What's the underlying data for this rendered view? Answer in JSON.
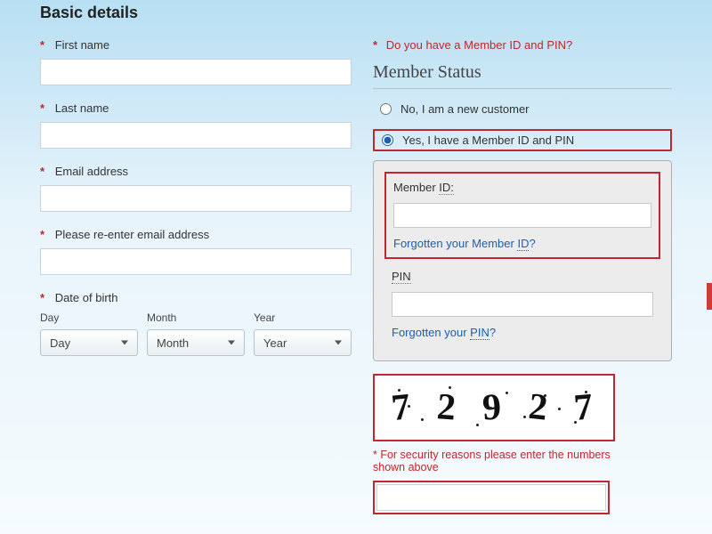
{
  "section_title": "Basic details",
  "left": {
    "first_name_label": "First name",
    "last_name_label": "Last name",
    "email_label": "Email address",
    "reemail_label": "Please re-enter email address",
    "dob_label": "Date of birth",
    "dob": {
      "day_label": "Day",
      "month_label": "Month",
      "year_label": "Year",
      "day_value": "Day",
      "month_value": "Month",
      "year_value": "Year"
    }
  },
  "right": {
    "question": "Do you have a Member ID and PIN?",
    "status_title": "Member Status",
    "option_no": "No, I am a new customer",
    "option_yes": "Yes, I have a Member ID and PIN",
    "selected": "yes",
    "member_id": {
      "label_a": "Member ",
      "label_b": "ID:",
      "forgot_a": "Forgotten your Member ",
      "forgot_b": "ID",
      "forgot_c": "?"
    },
    "pin": {
      "label": "PIN",
      "forgot_a": "Forgotten your ",
      "forgot_b": "PIN",
      "forgot_c": "?"
    },
    "captcha": {
      "digits": [
        "7",
        "2",
        "9",
        "2",
        "7"
      ],
      "note": "* For security reasons please enter the numbers shown above"
    }
  }
}
